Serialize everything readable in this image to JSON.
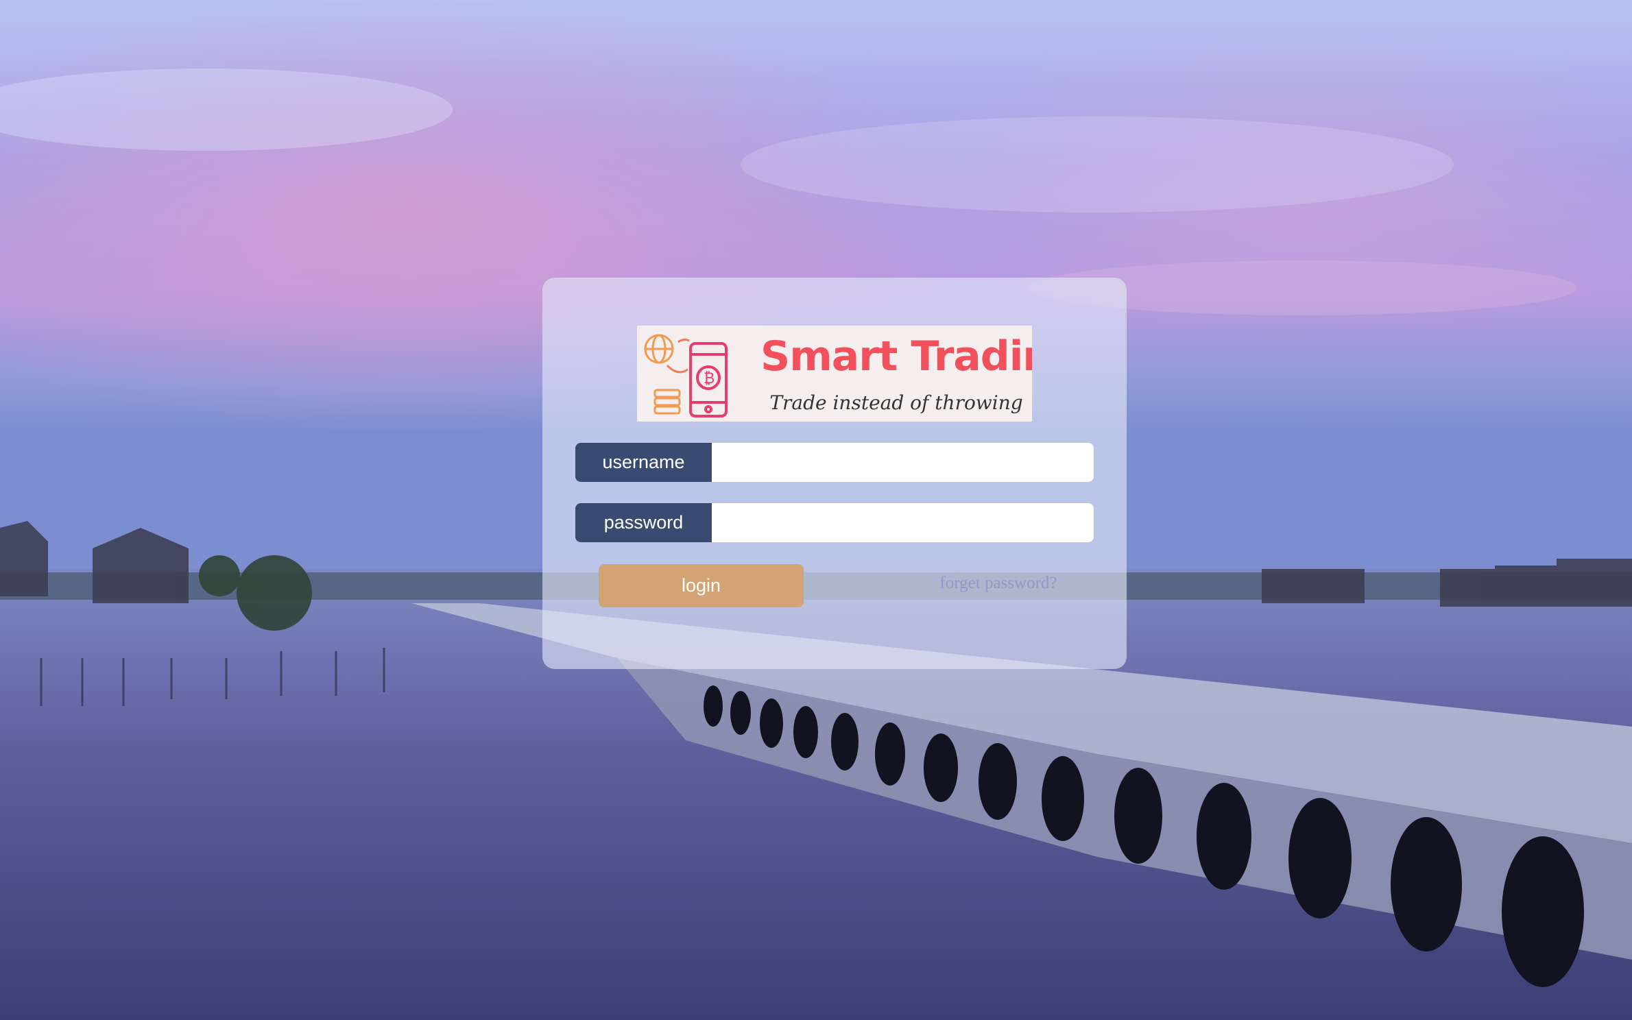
{
  "brand": {
    "title": "Smart Trading",
    "tagline": "Trade instead of throwing",
    "title_color": "#f2505d"
  },
  "form": {
    "username_label": "username",
    "username_value": "",
    "password_label": "password",
    "password_value": "",
    "login_label": "login",
    "forget_label": "forget password?"
  },
  "colors": {
    "label_bg": "#394b70",
    "login_bg": "#d3a374",
    "forget_text": "#9497c7"
  },
  "icons": [
    "globe-icon",
    "refresh-arrow-icon",
    "bitcoin-phone-icon",
    "coin-stack-icon"
  ]
}
